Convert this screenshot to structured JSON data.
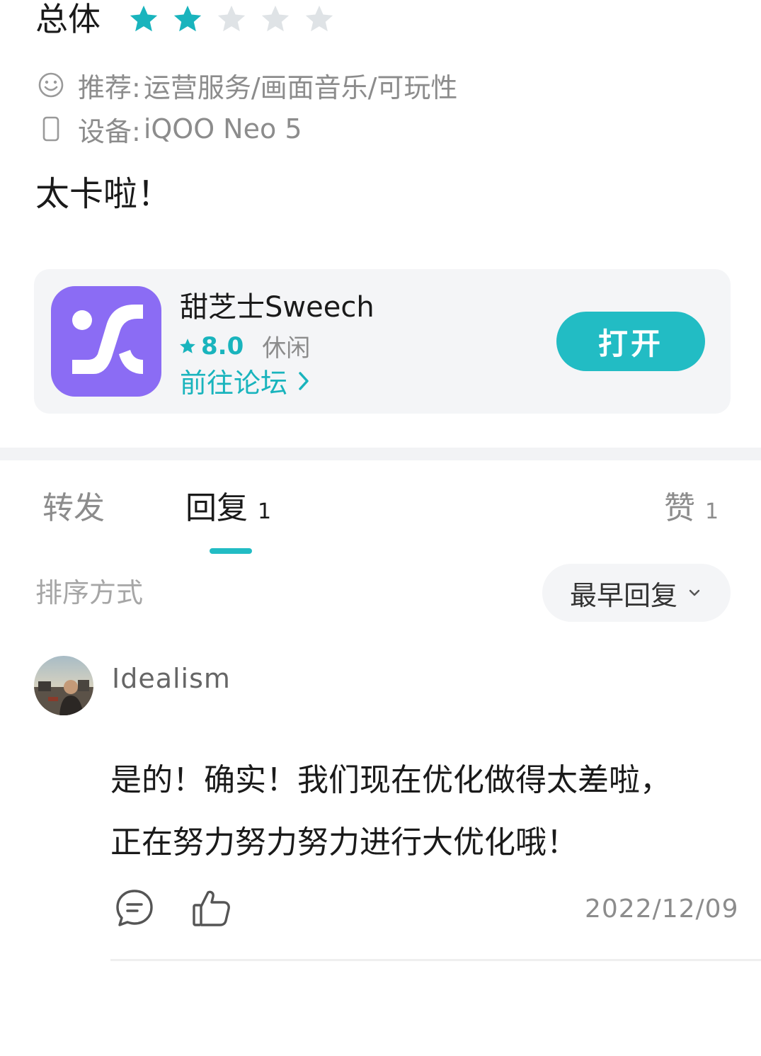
{
  "review": {
    "rating_label": "总体",
    "rating_value": 2,
    "rating_max": 5,
    "recommend_label": "推荐:",
    "recommend_value": "运营服务/画面音乐/可玩性",
    "device_label": "设备:",
    "device_value": "iQOO Neo 5",
    "text": "太卡啦！",
    "icons": {
      "recommend": "smiley-icon",
      "device": "phone-icon",
      "star": "star-icon"
    }
  },
  "app_card": {
    "name": "甜芝士Sweech",
    "score": "8.0",
    "category": "休闲",
    "forum_link": "前往论坛",
    "open_button": "打开",
    "icon_color": "#8b6cf4"
  },
  "tabs": [
    {
      "label": "转发",
      "count": ""
    },
    {
      "label": "回复",
      "count": "1",
      "active": true
    },
    {
      "label": "赞",
      "count": "1"
    }
  ],
  "sort": {
    "label": "排序方式",
    "selected": "最早回复"
  },
  "reply": {
    "username": "Idealism",
    "text_line1": "是的！确实！我们现在优化做得太差啦，",
    "text_line2": "正在努力努力努力进行大优化哦！",
    "date": "2022/12/09",
    "icons": {
      "comment": "comment-icon",
      "like": "thumbs-up-icon"
    }
  },
  "colors": {
    "accent": "#22bcc4",
    "star_filled": "#19b4bd",
    "star_empty": "#dfe3e6"
  }
}
